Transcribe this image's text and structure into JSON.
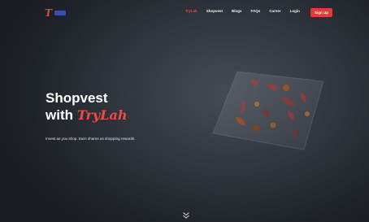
{
  "brand": {
    "logo_mark": "T",
    "accent": "#e53935",
    "badge_color": "#3b4cb8"
  },
  "nav": {
    "items": [
      {
        "label": "TryLah",
        "active": true
      },
      {
        "label": "Shopvest",
        "active": false
      },
      {
        "label": "Blogs",
        "active": false
      },
      {
        "label": "FAQs",
        "active": false
      },
      {
        "label": "Career",
        "active": false
      },
      {
        "label": "Login",
        "active": false
      }
    ],
    "signup_label": "Sign Up"
  },
  "hero": {
    "title_line1": "Shopvest",
    "title_line2_prefix": "with",
    "title_brand": "TryLah",
    "subtitle": "Invest as you shop. Earn shares as shopping rewards."
  },
  "icons": {
    "scroll": "double-chevron-down-icon"
  }
}
